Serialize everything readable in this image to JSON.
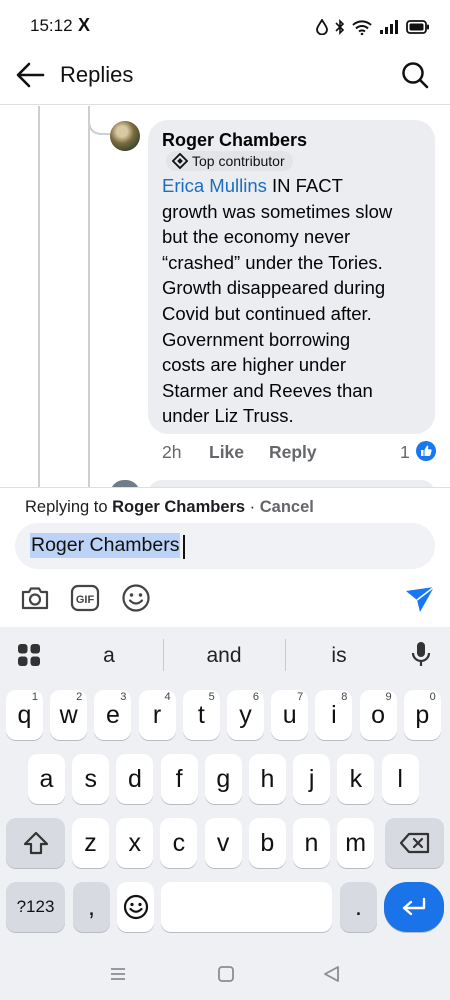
{
  "status_bar": {
    "time": "15:12",
    "app_icon": "X"
  },
  "header": {
    "title": "Replies"
  },
  "comment": {
    "author": "Roger Chambers",
    "badge": "Top contributor",
    "mention": "Erica Mullins",
    "text_lines": [
      " IN FACT",
      "growth was sometimes slow",
      "but the economy never",
      "“crashed” under the Tories.",
      "Growth disappeared during",
      "Covid but continued after.",
      "Government borrowing",
      "costs are higher under",
      "Starmer and Reeves than",
      "under Liz Truss."
    ],
    "time_ago": "2h",
    "like_label": "Like",
    "reply_label": "Reply",
    "reaction_count": "1"
  },
  "composer": {
    "replying_prefix": "Replying to ",
    "replying_name": "Roger Chambers",
    "replying_sep": " · ",
    "cancel_label": "Cancel",
    "input_value": "Roger Chambers",
    "gif_label": "GIF",
    "accent": "#1877f2"
  },
  "keyboard": {
    "suggestions": [
      "a",
      "and",
      "is"
    ],
    "row1": [
      {
        "key": "q",
        "hint": "1"
      },
      {
        "key": "w",
        "hint": "2"
      },
      {
        "key": "e",
        "hint": "3"
      },
      {
        "key": "r",
        "hint": "4"
      },
      {
        "key": "t",
        "hint": "5"
      },
      {
        "key": "y",
        "hint": "6"
      },
      {
        "key": "u",
        "hint": "7"
      },
      {
        "key": "i",
        "hint": "8"
      },
      {
        "key": "o",
        "hint": "9"
      },
      {
        "key": "p",
        "hint": "0"
      }
    ],
    "row2": [
      "a",
      "s",
      "d",
      "f",
      "g",
      "h",
      "j",
      "k",
      "l"
    ],
    "row3": [
      "z",
      "x",
      "c",
      "v",
      "b",
      "n",
      "m"
    ],
    "symbols_label": "?123",
    "comma": ",",
    "period": ".",
    "enter_color": "#1a73e8"
  }
}
